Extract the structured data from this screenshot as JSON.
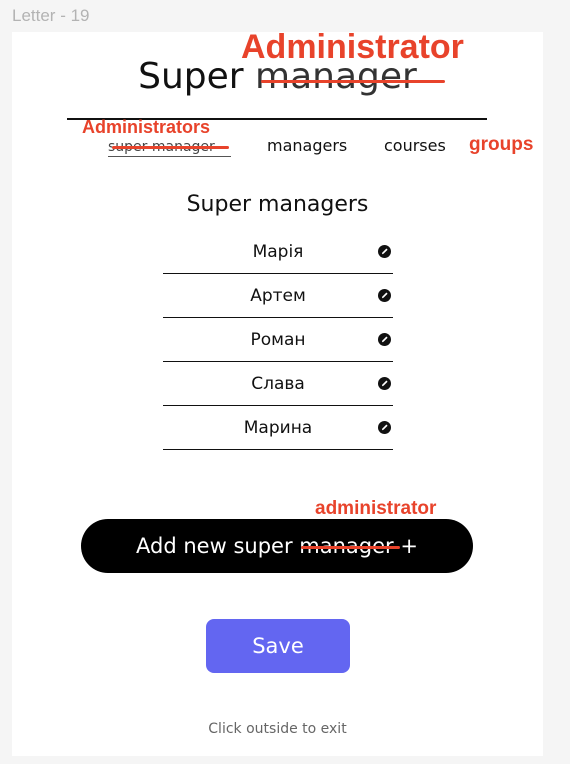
{
  "frame_label": "Letter - 19",
  "header": {
    "title_prefix": "Super",
    "title_struck": "manager",
    "title_correction": "Administrator"
  },
  "tabs": {
    "super_manager": "super manager",
    "super_manager_correction": "Administrators",
    "managers": "managers",
    "courses": "courses",
    "correction_extra": "groups"
  },
  "section_title": "Super managers",
  "managers": [
    {
      "name": "Марія"
    },
    {
      "name": "Артем"
    },
    {
      "name": "Роман"
    },
    {
      "name": "Слава"
    },
    {
      "name": "Марина"
    }
  ],
  "add_button": {
    "prefix": "Add new super",
    "struck": "manager",
    "suffix": "+",
    "correction": "administrator"
  },
  "save_label": "Save",
  "exit_hint": "Click outside to exit",
  "colors": {
    "accent": "#6366f1",
    "annotation": "#e8432b"
  },
  "icons": {
    "edit": "pencil-icon"
  }
}
